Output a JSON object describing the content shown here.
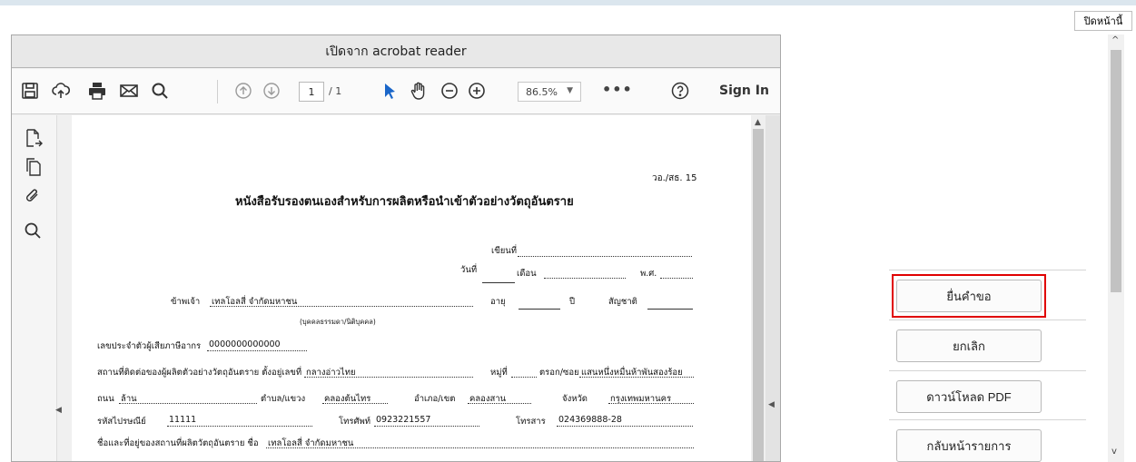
{
  "header": {
    "close_page_label": "ปิดหน้านี้"
  },
  "viewer": {
    "title": "เปิดจาก acrobat reader",
    "toolbar": {
      "save": "save-icon",
      "upload": "upload-cloud-icon",
      "print": "print-icon",
      "mail": "mail-icon",
      "search": "search-icon",
      "page_current": "1",
      "page_total": "/ 1",
      "zoom": "86.5%",
      "more": "•••",
      "sign_in": "Sign In"
    },
    "document": {
      "form_code": "วอ./สธ. 15",
      "title": "หนังสือรับรองตนเองสำหรับการผลิตหรือนำเข้าตัวอย่างวัตถุอันตราย",
      "written_at_label": "เขียนที่",
      "date_label": "วันที่",
      "month_label": "เดือน",
      "year_label": "พ.ศ.",
      "i_label": "ข้าพเจ้า",
      "applicant_name": "เทลโอลสี่ จำกัดมหาชน",
      "age_label": "อายุ",
      "years_label": "ปี",
      "nationality_label": "สัญชาติ",
      "person_type_hint": "(บุคคลธรรมดา/นิติบุคคล)",
      "tax_id_label": "เลขประจำตัวผู้เสียภาษีอากร",
      "tax_id": "0000000000000",
      "contact_place_label": "สถานที่ติดต่อของผู้ผลิตตัวอย่างวัตถุอันตราย ตั้งอยู่เลขที่",
      "house_no": "กลางอ่าวไทย",
      "moo_label": "หมู่ที่",
      "soi_label": "ตรอก/ซอย",
      "soi": "แสนหนึ่งหมื่นห้าพันสองร้อย",
      "road_label": "ถนน",
      "road": "ล้าน",
      "subdistrict_label": "ตำบล/แขวง",
      "subdistrict": "คลองต้นไทร",
      "district_label": "อำเภอ/เขต",
      "district": "คลองสาน",
      "province_label": "จังหวัด",
      "province": "กรุงเทพมหานคร",
      "postcode_label": "รหัสไปรษณีย์",
      "postcode": "11111",
      "phone_label": "โทรศัพท์",
      "phone": "0923221557",
      "fax_label": "โทรสาร",
      "fax": "024369888-28",
      "facility_label": "ชื่อและที่อยู่ของสถานที่ผลิตวัตถุอันตราย ชื่อ",
      "facility_name": "เทลโอลสี่ จำกัดมหาชน"
    }
  },
  "actions": {
    "submit": "ยื่นคำขอ",
    "cancel": "ยกเลิก",
    "download": "ดาวน์โหลด PDF",
    "back": "กลับหน้ารายการ"
  },
  "colors": {
    "highlight": "#e00000",
    "title_bar": "#e8e8e8",
    "toolbar": "#fafafa"
  }
}
